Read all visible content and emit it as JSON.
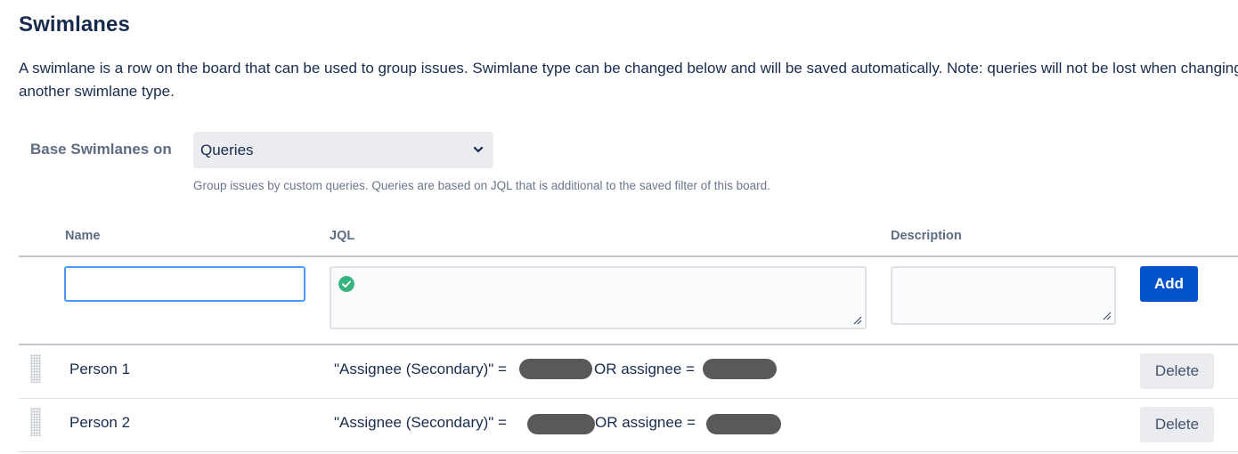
{
  "page": {
    "title": "Swimlanes",
    "description": "A swimlane is a row on the board that can be used to group issues. Swimlane type can be changed below and will be saved automatically. Note: queries will not be lost when changing to another swimlane type."
  },
  "base": {
    "label": "Base Swimlanes on",
    "selected": "Queries",
    "help": "Group issues by custom queries. Queries are based on JQL that is additional to the saved filter of this board."
  },
  "table": {
    "headers": {
      "name": "Name",
      "jql": "JQL",
      "description": "Description"
    },
    "new_row": {
      "name_value": "",
      "jql_value": "",
      "description_value": "",
      "jql_valid": true,
      "add_label": "Add"
    },
    "rows": [
      {
        "name": "Person 1",
        "jql_part1": "\"Assignee (Secondary)\" =",
        "jql_part2": "OR assignee =",
        "delete_label": "Delete"
      },
      {
        "name": "Person 2",
        "jql_part1": "\"Assignee (Secondary)\" =",
        "jql_part2": "OR assignee =",
        "delete_label": "Delete"
      }
    ]
  },
  "colors": {
    "primary": "#0052cc",
    "valid": "#36b37e",
    "focus": "#4c9aff",
    "redaction": "#595959"
  }
}
